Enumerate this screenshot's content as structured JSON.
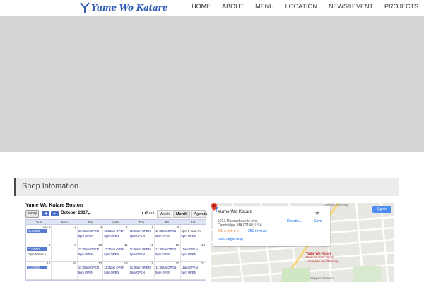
{
  "header": {
    "logo_text": "Yume Wo Katare",
    "nav": [
      "HOME",
      "ABOUT",
      "MENU",
      "LOCATION",
      "NEWS&EVENT",
      "PROJECTS"
    ]
  },
  "section": {
    "title": "Shop Infomation"
  },
  "calendar": {
    "title": "Yume Wo Katare Boston",
    "today_label": "Today",
    "month_label": "October 2017",
    "print_label": "Print",
    "views": [
      "Week",
      "Month",
      "Agenda"
    ],
    "weekdays": [
      "Sun",
      "Mon",
      "Tue",
      "Wed",
      "Thu",
      "Fri",
      "Sat"
    ],
    "weeks": [
      {
        "days": [
          "Oct 1",
          "2",
          "3",
          "4",
          "5",
          "6",
          "7"
        ],
        "events": [
          [
            "CLOSED",
            "",
            "11:30am OPEN|5pm OPEN",
            "11:30am OPEN|5pm OPEN",
            "11:30am OPEN|5pm OPEN",
            "11:30am OPEN|5pm OPEN",
            "2pm 5 Year An|5pm OPEN"
          ]
        ]
      },
      {
        "days": [
          "8",
          "9",
          "10",
          "11",
          "12",
          "13",
          "14"
        ],
        "events": [
          [
            "CLOSED|12pm 5 Year A",
            "",
            "11:30am OPEN|5pm OPEN",
            "11:30am OPEN|5pm OPEN",
            "11:30am OPEN|5pm OPEN",
            "11:30am OPEN|5pm OPEN",
            "11am OPEN|5pm OPEN"
          ]
        ]
      },
      {
        "days": [
          "15",
          "16",
          "17",
          "18",
          "19",
          "20",
          "21"
        ],
        "events": [
          [
            "CLOSED",
            "",
            "11:30am OPEN|5pm OPEN",
            "11:30am OPEN|5pm OPEN",
            "11:30am OPEN|5pm OPEN",
            "11:30am OPEN|5pm OPEN",
            "11am OPEN|5pm OPEN"
          ]
        ]
      }
    ]
  },
  "map": {
    "name": "Yume Wo Katare",
    "address_line1": "1923 Massachusetts Ave,",
    "address_line2": "Cambridge, MA 02140, USA",
    "rating": "4.5 ★★★★☆",
    "reviews": "251 reviews",
    "larger_map": "View larger map",
    "directions": "Directio...",
    "save": "Save",
    "sign_in": "Sign in",
    "pin_title": "Yume Wo Katare",
    "pin_desc1": "Busy counter-serve",
    "pin_desc2": "Japanese noodle shop",
    "place_bottom": "Sapporo Ramen",
    "place_top": "Lesley University"
  },
  "colors": {
    "accent": "#2e5db5",
    "hero": "#d4d4d4",
    "calendar_header": "#dde4f3",
    "closed_event": "#5a7bd3"
  }
}
